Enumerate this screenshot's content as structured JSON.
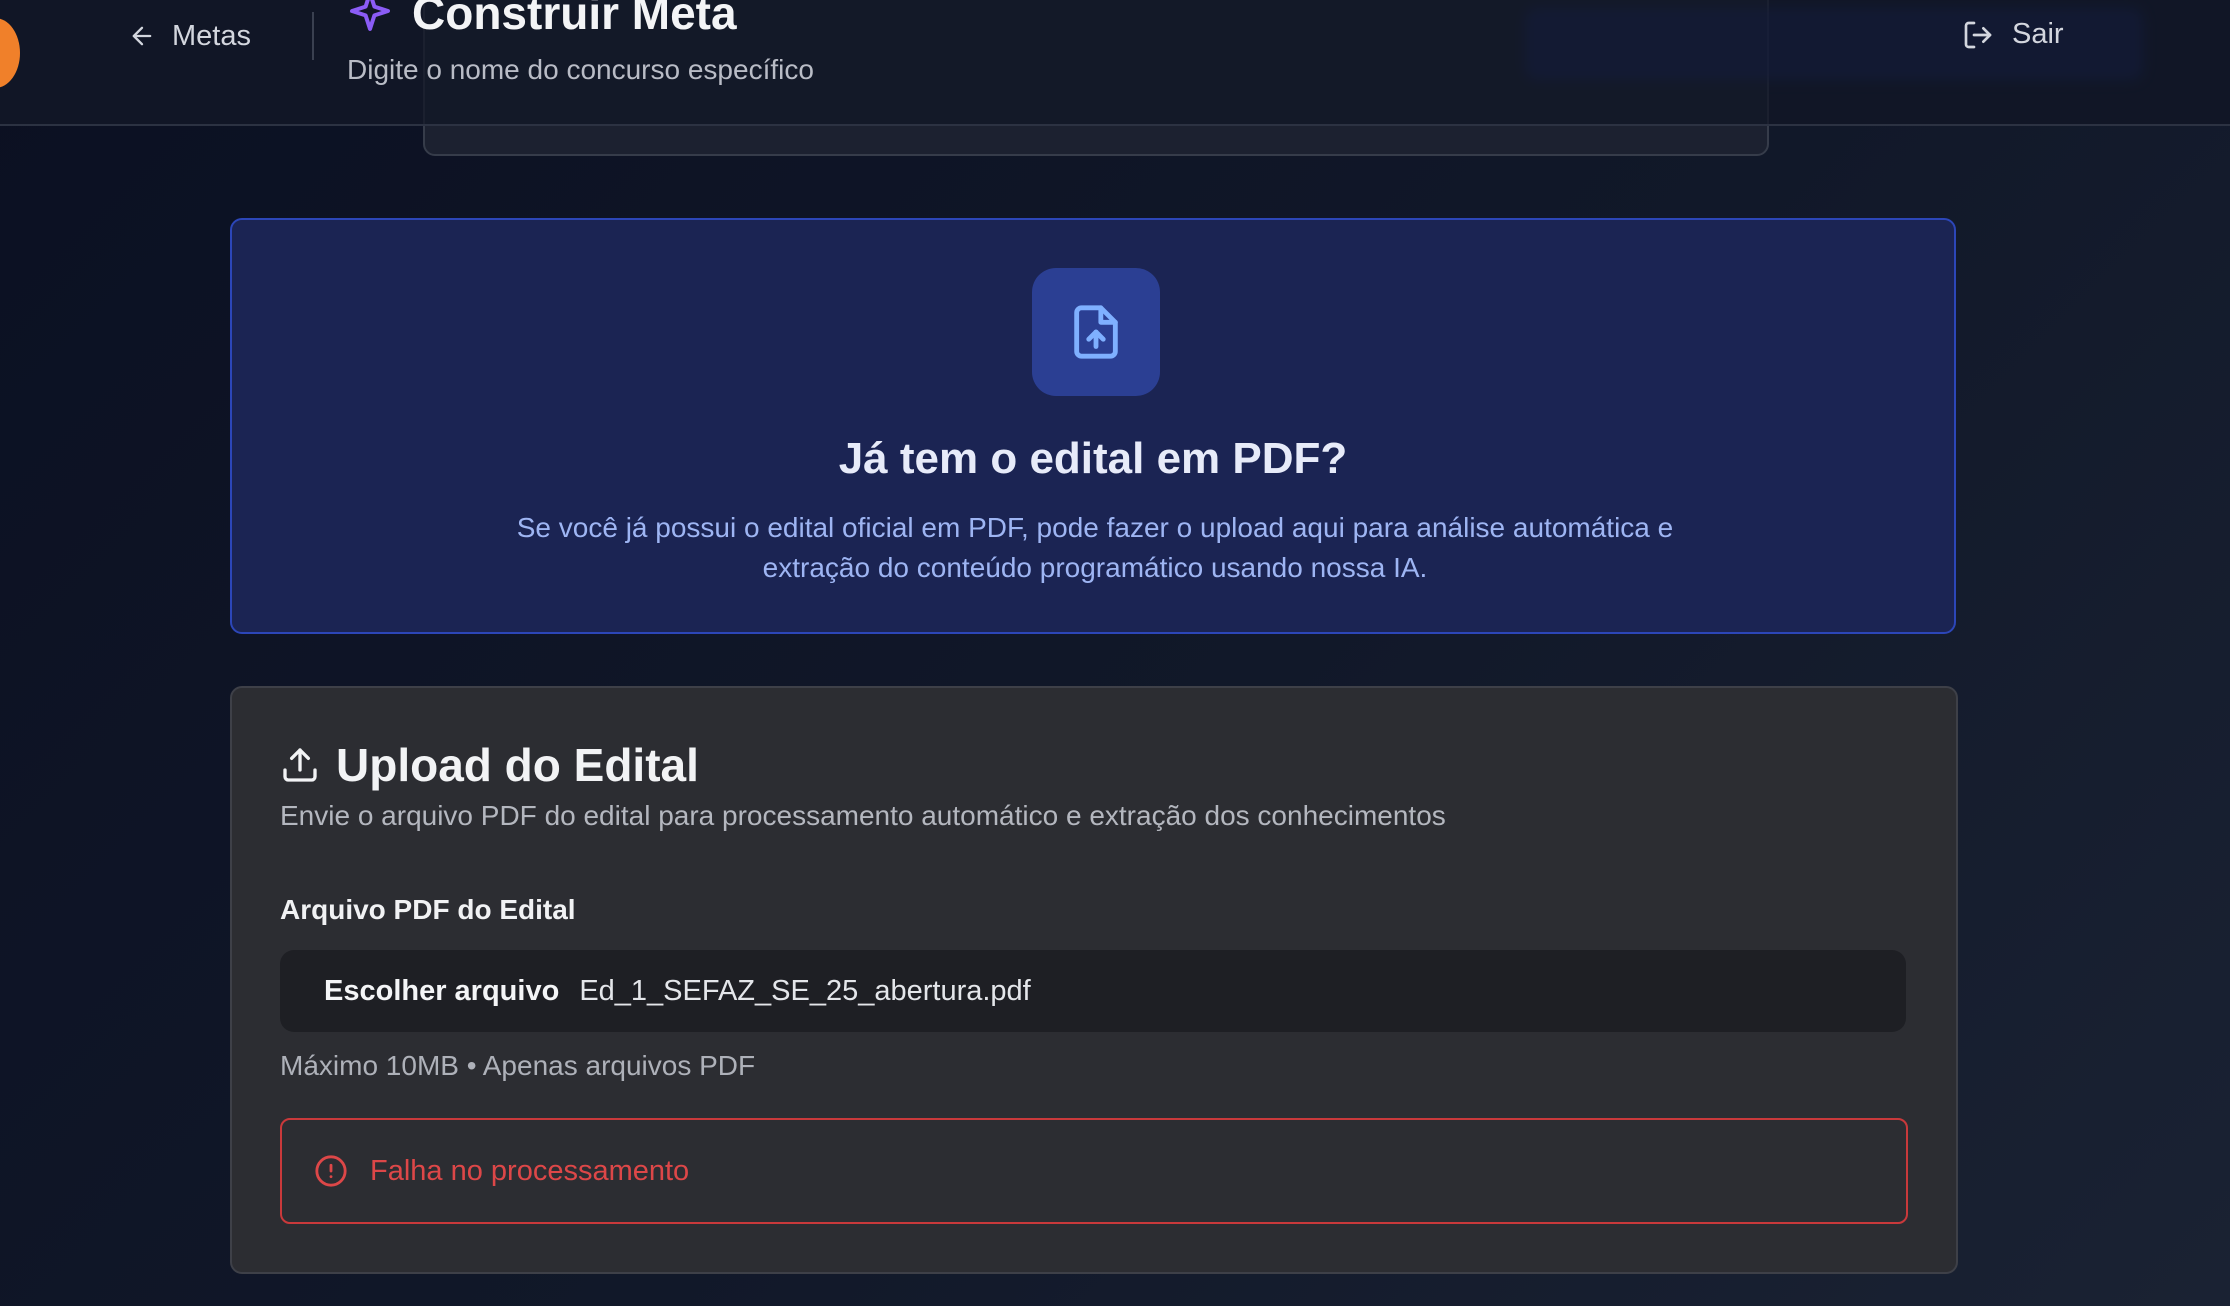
{
  "header": {
    "back_label": "Metas",
    "title": "Construir Meta",
    "subtitle": "Digite o nome do concurso específico",
    "logout_label": "Sair"
  },
  "info_card": {
    "title": "Já tem o edital em PDF?",
    "text": "Se você já possui o edital oficial em PDF, pode fazer o upload aqui para análise automática e extração do conteúdo programático usando nossa IA.",
    "icon": "file-upload-icon"
  },
  "upload": {
    "title": "Upload do Edital",
    "description": "Envie o arquivo PDF do edital para processamento automático e extração dos conhecimentos",
    "field_label": "Arquivo PDF do Edital",
    "choose_label": "Escolher arquivo",
    "file_name": "Ed_1_SEFAZ_SE_25_abertura.pdf",
    "hint": "Máximo 10MB • Apenas arquivos PDF",
    "error": "Falha no processamento"
  },
  "colors": {
    "accent": "#2c46b8",
    "error": "#dd4748",
    "sparkle": "#8b5cf6"
  }
}
